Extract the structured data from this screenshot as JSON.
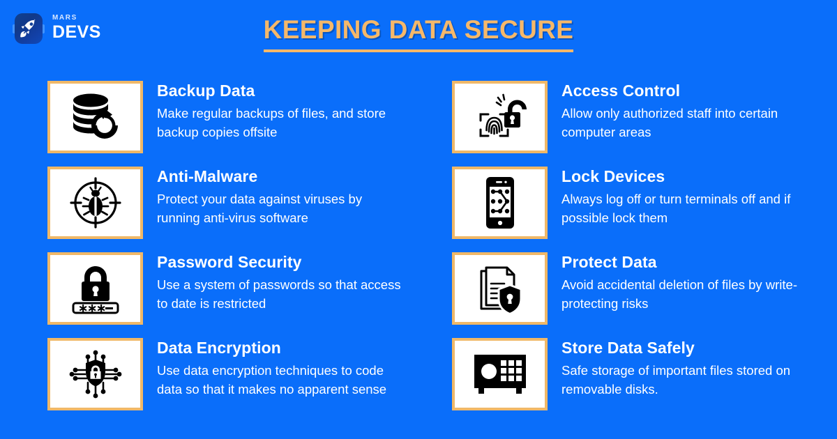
{
  "brand": {
    "sub": "MARS",
    "main": "DEVS",
    "logo_icon": "rocket-icon"
  },
  "header": {
    "title": "KEEPING DATA SECURE"
  },
  "colors": {
    "background": "#0a6efa",
    "accent": "#f5b86a",
    "card_border": "#f0b868",
    "icon_fill": "#000000",
    "text": "#ffffff"
  },
  "columns": [
    {
      "cards": [
        {
          "icon": "database-backup-icon",
          "title": "Backup Data",
          "desc": "Make regular backups of files, and store backup copies offsite"
        },
        {
          "icon": "bug-target-icon",
          "title": "Anti-Malware",
          "desc": "Protect your data against viruses by running anti-virus software"
        },
        {
          "icon": "padlock-password-icon",
          "title": "Password Security",
          "desc": "Use a system of passwords so that access to date is restricted"
        },
        {
          "icon": "shield-circuit-lock-icon",
          "title": "Data Encryption",
          "desc": "Use data encryption techniques to code data so that it makes no apparent sense"
        }
      ]
    },
    {
      "cards": [
        {
          "icon": "fingerprint-unlock-icon",
          "title": "Access Control",
          "desc": "Allow only authorized staff into certain computer areas"
        },
        {
          "icon": "phone-pattern-lock-icon",
          "title": "Lock Devices",
          "desc": "Always log off or turn terminals off and if possible lock them"
        },
        {
          "icon": "documents-shield-icon",
          "title": "Protect Data",
          "desc": "Avoid accidental deletion of files by write-protecting risks"
        },
        {
          "icon": "safe-vault-icon",
          "title": "Store Data Safely",
          "desc": "Safe storage of important files stored on removable disks."
        }
      ]
    }
  ]
}
